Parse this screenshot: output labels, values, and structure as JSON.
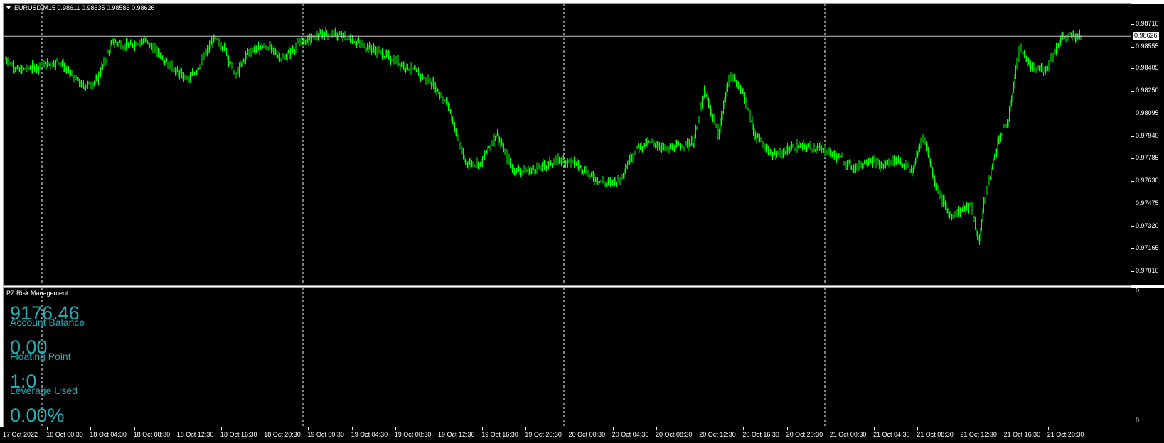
{
  "chart": {
    "symbol_line": "EURUSD,M15  0.98611 0.98635 0.98586 0.98626",
    "current_price": "0.98626",
    "price_labels": [
      "0.98710",
      "0.98555",
      "0.98405",
      "0.98250",
      "0.98095",
      "0.97940",
      "0.97785",
      "0.97630",
      "0.97475",
      "0.97320",
      "0.97165",
      "0.97010"
    ],
    "time_labels": [
      "17 Oct 2022",
      "18 Oct 00:30",
      "18 Oct 04:30",
      "18 Oct 08:30",
      "18 Oct 12:30",
      "18 Oct 16:30",
      "18 Oct 20:30",
      "19 Oct 00:30",
      "19 Oct 04:30",
      "19 Oct 08:30",
      "19 Oct 12:30",
      "19 Oct 16:30",
      "19 Oct 20:30",
      "20 Oct 00:30",
      "20 Oct 04:30",
      "20 Oct 08:30",
      "20 Oct 12:30",
      "20 Oct 16:30",
      "20 Oct 20:30",
      "21 Oct 00:30",
      "21 Oct 04:30",
      "21 Oct 08:30",
      "21 Oct 12:30",
      "21 Oct 16:30",
      "21 Oct 20:30"
    ],
    "candle_color": "#00ff00",
    "line_anchors": [
      [
        0,
        0.9847
      ],
      [
        12,
        0.9839
      ],
      [
        30,
        0.9842
      ],
      [
        50,
        0.9845
      ],
      [
        72,
        0.9828
      ],
      [
        85,
        0.9832
      ],
      [
        100,
        0.9859
      ],
      [
        115,
        0.9856
      ],
      [
        130,
        0.986
      ],
      [
        145,
        0.985
      ],
      [
        160,
        0.9838
      ],
      [
        172,
        0.9833
      ],
      [
        182,
        0.9843
      ],
      [
        195,
        0.9861
      ],
      [
        205,
        0.9855
      ],
      [
        215,
        0.9835
      ],
      [
        228,
        0.9853
      ],
      [
        245,
        0.9856
      ],
      [
        260,
        0.9847
      ],
      [
        275,
        0.9858
      ],
      [
        300,
        0.9865
      ],
      [
        318,
        0.9862
      ],
      [
        338,
        0.9856
      ],
      [
        360,
        0.9848
      ],
      [
        380,
        0.984
      ],
      [
        400,
        0.983
      ],
      [
        415,
        0.9815
      ],
      [
        430,
        0.9776
      ],
      [
        445,
        0.9775
      ],
      [
        460,
        0.9796
      ],
      [
        475,
        0.9771
      ],
      [
        490,
        0.977
      ],
      [
        505,
        0.9774
      ],
      [
        520,
        0.9778
      ],
      [
        535,
        0.9775
      ],
      [
        548,
        0.9767
      ],
      [
        562,
        0.9761
      ],
      [
        575,
        0.9764
      ],
      [
        590,
        0.9785
      ],
      [
        605,
        0.979
      ],
      [
        620,
        0.9785
      ],
      [
        635,
        0.9788
      ],
      [
        645,
        0.979
      ],
      [
        655,
        0.9825
      ],
      [
        668,
        0.9795
      ],
      [
        678,
        0.9835
      ],
      [
        690,
        0.9827
      ],
      [
        702,
        0.9795
      ],
      [
        720,
        0.978
      ],
      [
        740,
        0.9787
      ],
      [
        760,
        0.9786
      ],
      [
        780,
        0.978
      ],
      [
        795,
        0.9772
      ],
      [
        810,
        0.9778
      ],
      [
        820,
        0.9773
      ],
      [
        835,
        0.9778
      ],
      [
        850,
        0.977
      ],
      [
        860,
        0.9795
      ],
      [
        872,
        0.976
      ],
      [
        885,
        0.9739
      ],
      [
        895,
        0.9743
      ],
      [
        905,
        0.9746
      ],
      [
        912,
        0.972
      ],
      [
        918,
        0.9752
      ],
      [
        930,
        0.979
      ],
      [
        940,
        0.9805
      ],
      [
        950,
        0.9855
      ],
      [
        962,
        0.984
      ],
      [
        975,
        0.984
      ],
      [
        990,
        0.9862
      ],
      [
        1002,
        0.9863
      ],
      [
        1010,
        0.9862
      ]
    ],
    "bar_count": 1010,
    "y_min": 0.9701,
    "y_max": 0.9871
  },
  "indicator": {
    "title": "PZ Risk Management",
    "scale_top": "0",
    "scale_bottom": "0",
    "account_balance_value": "9176.46",
    "account_balance_label": "Account Balance",
    "floating_point_value": "0.00",
    "floating_point_label": "Floating Point",
    "leverage_value": "1:0",
    "leverage_label": "Leverage Used",
    "risk_value": "0.00%"
  }
}
